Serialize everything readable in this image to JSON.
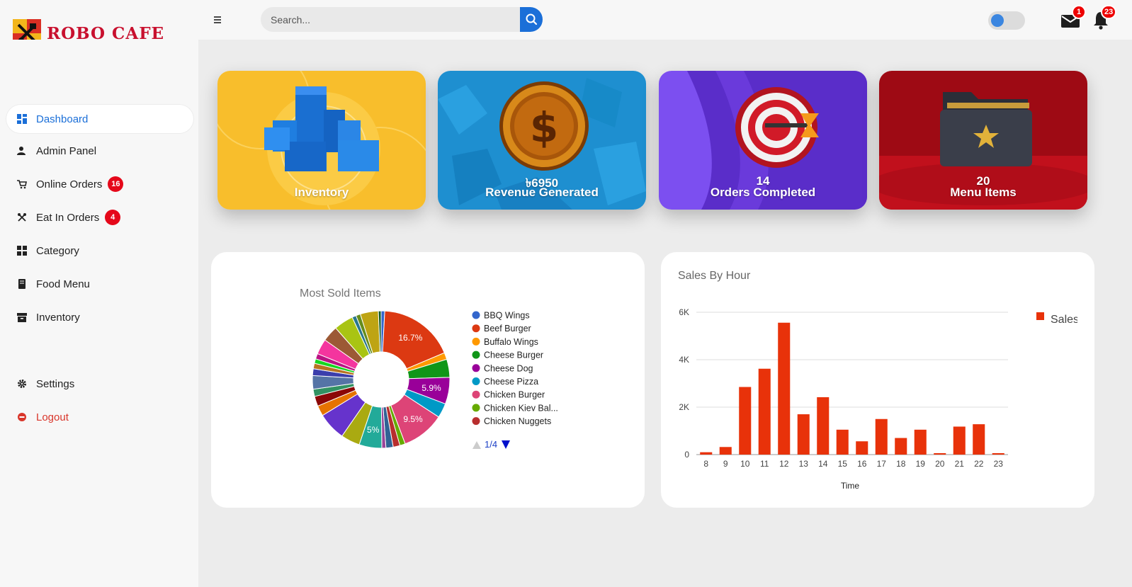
{
  "brand": {
    "name": "ROBO CAFE"
  },
  "search": {
    "placeholder": "Search..."
  },
  "header": {
    "mail_count": "1",
    "notification_count": "23"
  },
  "sidebar": {
    "items": [
      {
        "label": "Dashboard",
        "icon": "dashboard-icon",
        "active": true
      },
      {
        "label": "Admin Panel",
        "icon": "admin-user-icon"
      },
      {
        "label": "Online Orders",
        "icon": "cart-icon",
        "badge": "16"
      },
      {
        "label": "Eat In Orders",
        "icon": "eat-in-icon",
        "badge": "4"
      },
      {
        "label": "Category",
        "icon": "category-grid-icon"
      },
      {
        "label": "Food Menu",
        "icon": "menu-book-icon"
      },
      {
        "label": "Inventory",
        "icon": "inventory-box-icon"
      },
      {
        "label": "Settings",
        "icon": "gear-icon"
      },
      {
        "label": "Logout",
        "icon": "logout-icon"
      }
    ]
  },
  "cards": [
    {
      "value": "",
      "title": "Inventory",
      "color": "#f8be2c"
    },
    {
      "value": "৳6950",
      "title": "Revenue Generated",
      "color": "#1e8fd0"
    },
    {
      "value": "14",
      "title": "Orders Completed",
      "color": "#6a3be0"
    },
    {
      "value": "20",
      "title": "Menu Items",
      "color": "#9e0a14"
    }
  ],
  "chart_data": [
    {
      "type": "pie",
      "title": "Most Sold Items",
      "donut": true,
      "legend_position": "right",
      "legend_visible": [
        "BBQ Wings",
        "Beef Burger",
        "Buffalo Wings",
        "Cheese Burger",
        "Cheese Dog",
        "Cheese Pizza",
        "Chicken Burger",
        "Chicken Kiev Bal...",
        "Chicken Nuggets"
      ],
      "legend_pager": "1/4",
      "slices": [
        {
          "label": "BBQ Wings",
          "value": 0.8,
          "color": "#3366cc"
        },
        {
          "label": "Beef Burger",
          "value": 16.7,
          "color": "#dc3912"
        },
        {
          "label": "Buffalo Wings",
          "value": 1.5,
          "color": "#ff9900"
        },
        {
          "label": "Cheese Burger",
          "value": 4.0,
          "color": "#109618"
        },
        {
          "label": "Cheese Dog",
          "value": 5.9,
          "color": "#990099"
        },
        {
          "label": "Cheese Pizza",
          "value": 3.2,
          "color": "#0099c6"
        },
        {
          "label": "Chicken Burger",
          "value": 9.5,
          "color": "#dd4477"
        },
        {
          "label": "Chicken Kiev Bal...",
          "value": 1.2,
          "color": "#66aa00"
        },
        {
          "label": "Chicken Nuggets",
          "value": 1.5,
          "color": "#b82e2e"
        },
        {
          "label": "",
          "value": 1.6,
          "color": "#316395"
        },
        {
          "label": "",
          "value": 0.9,
          "color": "#994499"
        },
        {
          "label": "",
          "value": 5.0,
          "color": "#22aa99"
        },
        {
          "label": "",
          "value": 4.2,
          "color": "#aaaa11"
        },
        {
          "label": "",
          "value": 6.2,
          "color": "#6633cc"
        },
        {
          "label": "",
          "value": 2.3,
          "color": "#e67300"
        },
        {
          "label": "",
          "value": 2.2,
          "color": "#8b0707"
        },
        {
          "label": "",
          "value": 1.6,
          "color": "#329262"
        },
        {
          "label": "",
          "value": 3.0,
          "color": "#5574a6"
        },
        {
          "label": "",
          "value": 1.5,
          "color": "#3b3eac"
        },
        {
          "label": "",
          "value": 1.2,
          "color": "#b77322"
        },
        {
          "label": "",
          "value": 1.0,
          "color": "#16d620"
        },
        {
          "label": "",
          "value": 1.2,
          "color": "#b91383"
        },
        {
          "label": "",
          "value": 3.4,
          "color": "#f4359e"
        },
        {
          "label": "",
          "value": 3.5,
          "color": "#9c5935"
        },
        {
          "label": "",
          "value": 4.3,
          "color": "#a9c413"
        },
        {
          "label": "",
          "value": 0.9,
          "color": "#2a778d"
        },
        {
          "label": "",
          "value": 1.0,
          "color": "#668d1c"
        },
        {
          "label": "",
          "value": 4.0,
          "color": "#bea413"
        },
        {
          "label": "",
          "value": 0.6,
          "color": "#0c5922"
        }
      ],
      "slice_labels": [
        "16.7%",
        "5.9%",
        "9.5%",
        "5%"
      ]
    },
    {
      "type": "bar",
      "title": "Sales By Hour",
      "xlabel": "Time",
      "ylabel": "",
      "categories": [
        "8",
        "9",
        "10",
        "11",
        "12",
        "13",
        "14",
        "15",
        "16",
        "17",
        "18",
        "19",
        "20",
        "21",
        "22",
        "23"
      ],
      "series": [
        {
          "name": "Sales",
          "color": "#e8320a",
          "values": [
            100,
            320,
            2850,
            3620,
            5560,
            1700,
            2420,
            1050,
            560,
            1500,
            700,
            1050,
            60,
            1180,
            1280,
            60
          ]
        }
      ],
      "ylim": [
        0,
        6000
      ],
      "yticks": [
        0,
        2000,
        4000,
        6000
      ],
      "ytick_labels": [
        "0",
        "2K",
        "4K",
        "6K"
      ],
      "grid": true,
      "legend_position": "right"
    }
  ]
}
